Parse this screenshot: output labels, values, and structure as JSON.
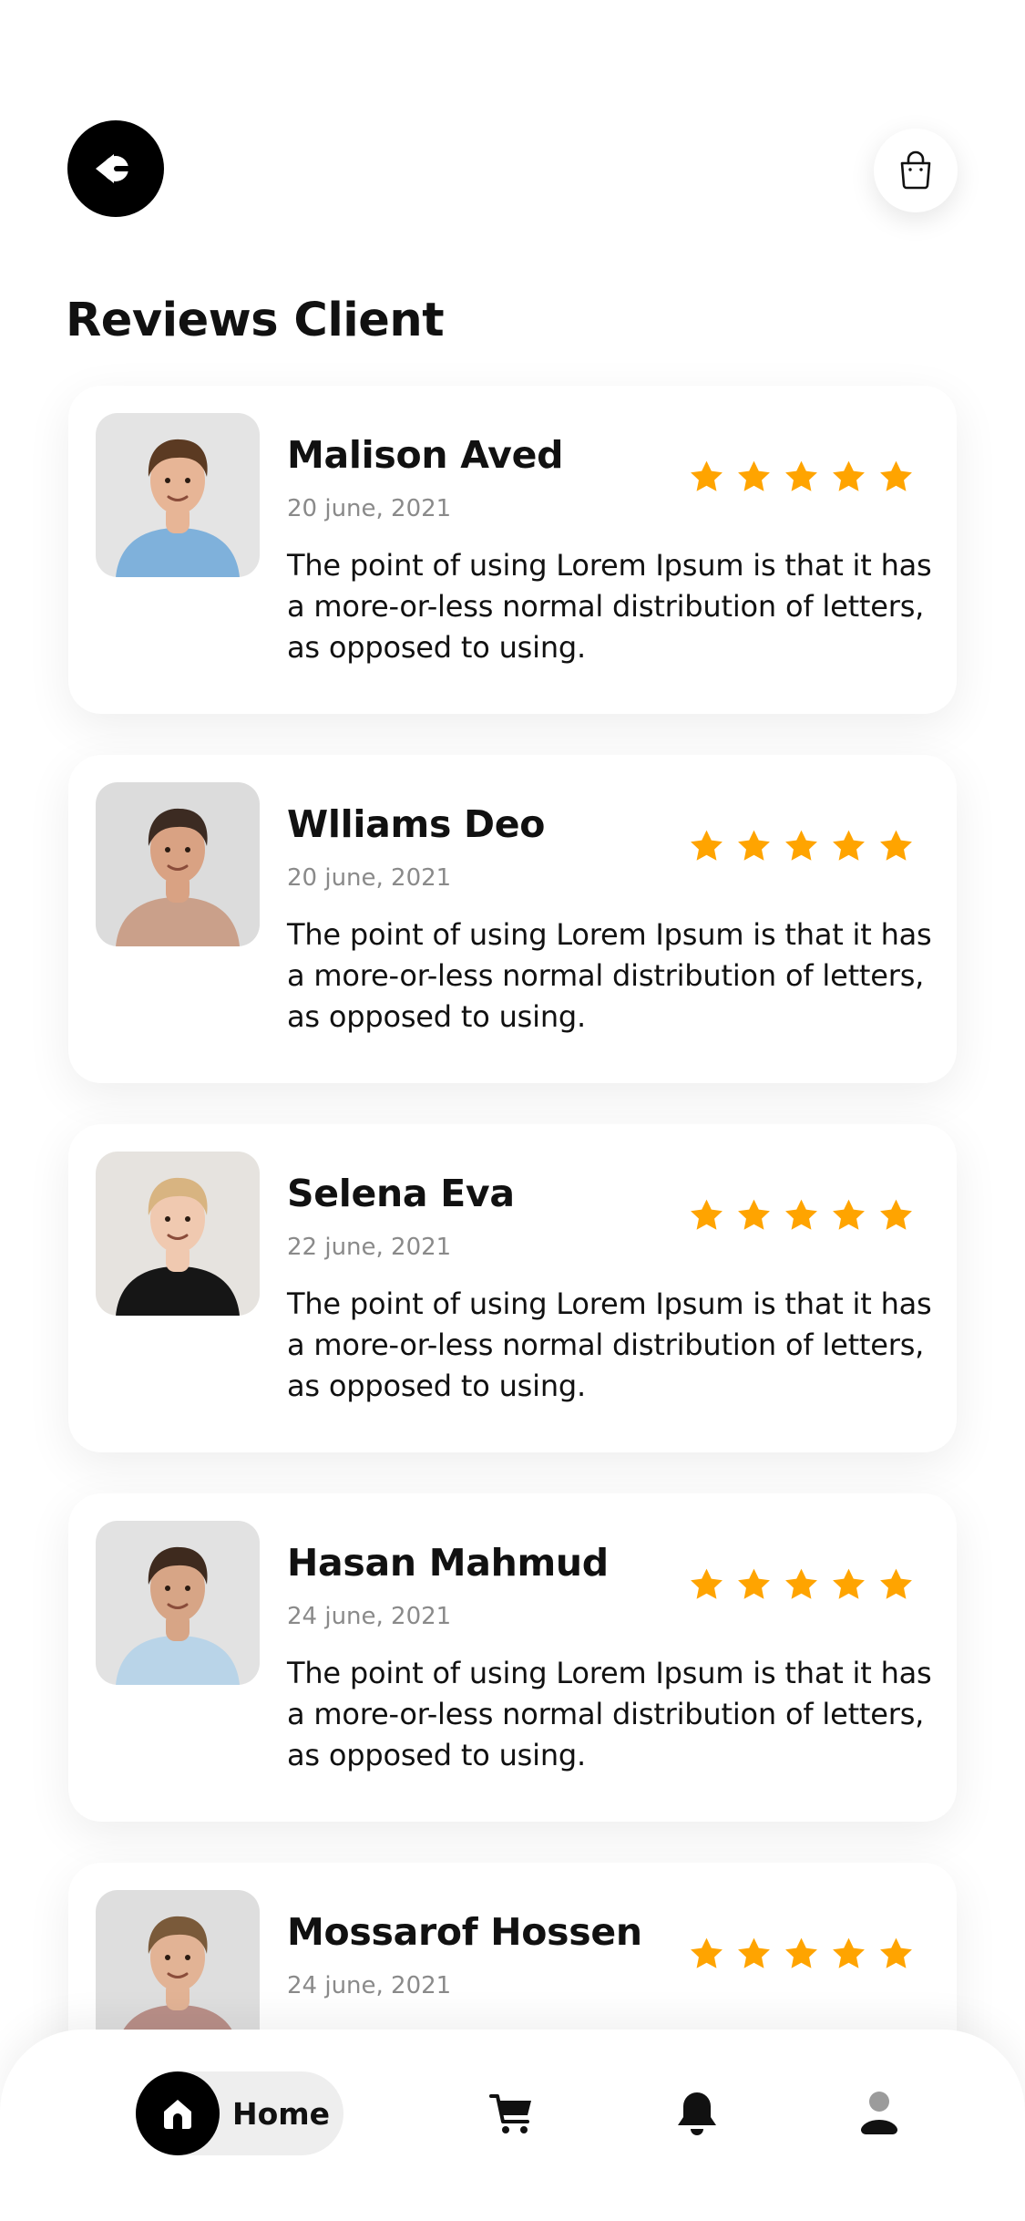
{
  "header": {
    "back_icon": "back-arrow-icon",
    "bag_icon": "shopping-bag-icon",
    "title": "Reviews Client"
  },
  "reviews": [
    {
      "name": "Malison Aved",
      "date": "20 june, 2021",
      "rating": 5,
      "text": "The point of using Lorem Ipsum is that it has a more-or-less normal distribution of letters, as opposed to using.",
      "avatar": {
        "bg": "#e4e4e4",
        "skin": "#e7b596",
        "hair": "#5b3a22",
        "shirt": "#7fb1db"
      }
    },
    {
      "name": "Wlliams Deo",
      "date": "20 june, 2021",
      "rating": 5,
      "text": "The point of using Lorem Ipsum is that it has a more-or-less normal distribution of letters, as opposed to using.",
      "avatar": {
        "bg": "#dcdcdc",
        "skin": "#d9a283",
        "hair": "#3c2b22",
        "shirt": "#caa08a"
      }
    },
    {
      "name": "Selena Eva",
      "date": "22 june, 2021",
      "rating": 5,
      "text": "The point of using Lorem Ipsum is that it has a more-or-less normal distribution of letters, as opposed to using.",
      "avatar": {
        "bg": "#e6e3df",
        "skin": "#f0c9b0",
        "hair": "#d8b481",
        "shirt": "#161616"
      }
    },
    {
      "name": "Hasan Mahmud",
      "date": "24 june, 2021",
      "rating": 5,
      "text": "The point of using Lorem Ipsum is that it has a more-or-less normal distribution of letters, as opposed to using.",
      "avatar": {
        "bg": "#e2e2e2",
        "skin": "#d7a586",
        "hair": "#3e2a1e",
        "shirt": "#b9d4e8"
      }
    },
    {
      "name": "Mossarof Hossen",
      "date": "24 june, 2021",
      "rating": 5,
      "text": "",
      "avatar": {
        "bg": "#dedede",
        "skin": "#e2b395",
        "hair": "#7a5a3a",
        "shirt": "#b98f88"
      }
    }
  ],
  "colors": {
    "star": "#ffa400",
    "text": "#111111",
    "muted": "#8a8a8a"
  },
  "bottom_nav": {
    "home_label": "Home",
    "home_icon": "home-icon",
    "cart_icon": "cart-icon",
    "bell_icon": "bell-icon",
    "profile_icon": "profile-icon"
  }
}
